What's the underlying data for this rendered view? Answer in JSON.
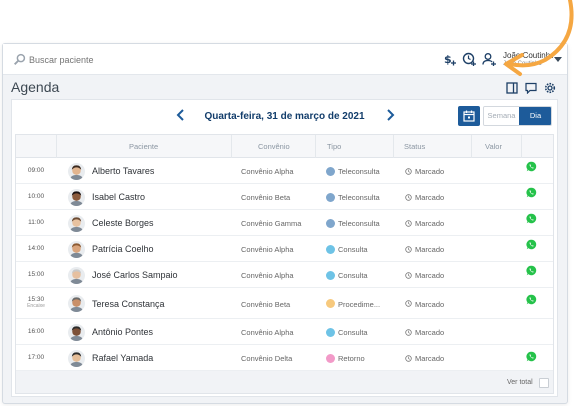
{
  "topbar": {
    "search_placeholder": "Buscar paciente",
    "user_name": "João Coutinho",
    "user_sub": "João Coutinho"
  },
  "page": {
    "title": "Agenda"
  },
  "toolbar": {
    "date": "Quarta-feira, 31 de março de 2021",
    "view_week": "Semana",
    "view_day": "Dia"
  },
  "table": {
    "headers": {
      "patient": "Paciente",
      "insurance": "Convênio",
      "type": "Tipo",
      "status": "Status",
      "value": "Valor"
    },
    "rows": [
      {
        "time": "09:00",
        "time_sub": "",
        "patient": "Alberto Tavares",
        "insurance": "Convênio Alpha",
        "type": "Teleconsulta",
        "type_color": "#7fa6cc",
        "status": "Marcado",
        "whatsapp": true
      },
      {
        "time": "10:00",
        "time_sub": "",
        "patient": "Isabel Castro",
        "insurance": "Convênio Beta",
        "type": "Teleconsulta",
        "type_color": "#7fa6cc",
        "status": "Marcado",
        "whatsapp": true
      },
      {
        "time": "11:00",
        "time_sub": "",
        "patient": "Celeste Borges",
        "insurance": "Convênio Gamma",
        "type": "Teleconsulta",
        "type_color": "#7fa6cc",
        "status": "Marcado",
        "whatsapp": true
      },
      {
        "time": "14:00",
        "time_sub": "",
        "patient": "Patrícia Coelho",
        "insurance": "Convênio Alpha",
        "type": "Consulta",
        "type_color": "#6ec3e6",
        "status": "Marcado",
        "whatsapp": true
      },
      {
        "time": "15:00",
        "time_sub": "",
        "patient": "José Carlos Sampaio",
        "insurance": "Convênio Alpha",
        "type": "Consulta",
        "type_color": "#6ec3e6",
        "status": "Marcado",
        "whatsapp": true
      },
      {
        "time": "15:30",
        "time_sub": "Encaixe",
        "patient": "Teresa Constança",
        "insurance": "Convênio Beta",
        "type": "Procedime...",
        "type_color": "#f7c97d",
        "status": "Marcado",
        "whatsapp": true
      },
      {
        "time": "16:00",
        "time_sub": "",
        "patient": "Antônio Pontes",
        "insurance": "Convênio Alpha",
        "type": "Consulta",
        "type_color": "#6ec3e6",
        "status": "Marcado",
        "whatsapp": false
      },
      {
        "time": "17:00",
        "time_sub": "",
        "patient": "Rafael Yamada",
        "insurance": "Convênio Delta",
        "type": "Retorno",
        "type_color": "#f29ac8",
        "status": "Marcado",
        "whatsapp": true
      }
    ],
    "footer_label": "Ver total"
  },
  "colors": {
    "primary": "#1d5b9a",
    "title": "#123d6b",
    "whatsapp": "#25c24a",
    "accent_arrow": "#f5a742"
  },
  "icons": [
    "search-icon",
    "dollar-plus-icon",
    "clock-plus-icon",
    "user-plus-icon",
    "sidebar-toggle-icon",
    "chat-icon",
    "gear-icon",
    "chevron-left-icon",
    "chevron-right-icon",
    "calendar-icon",
    "whatsapp-icon",
    "clock-status-icon"
  ]
}
